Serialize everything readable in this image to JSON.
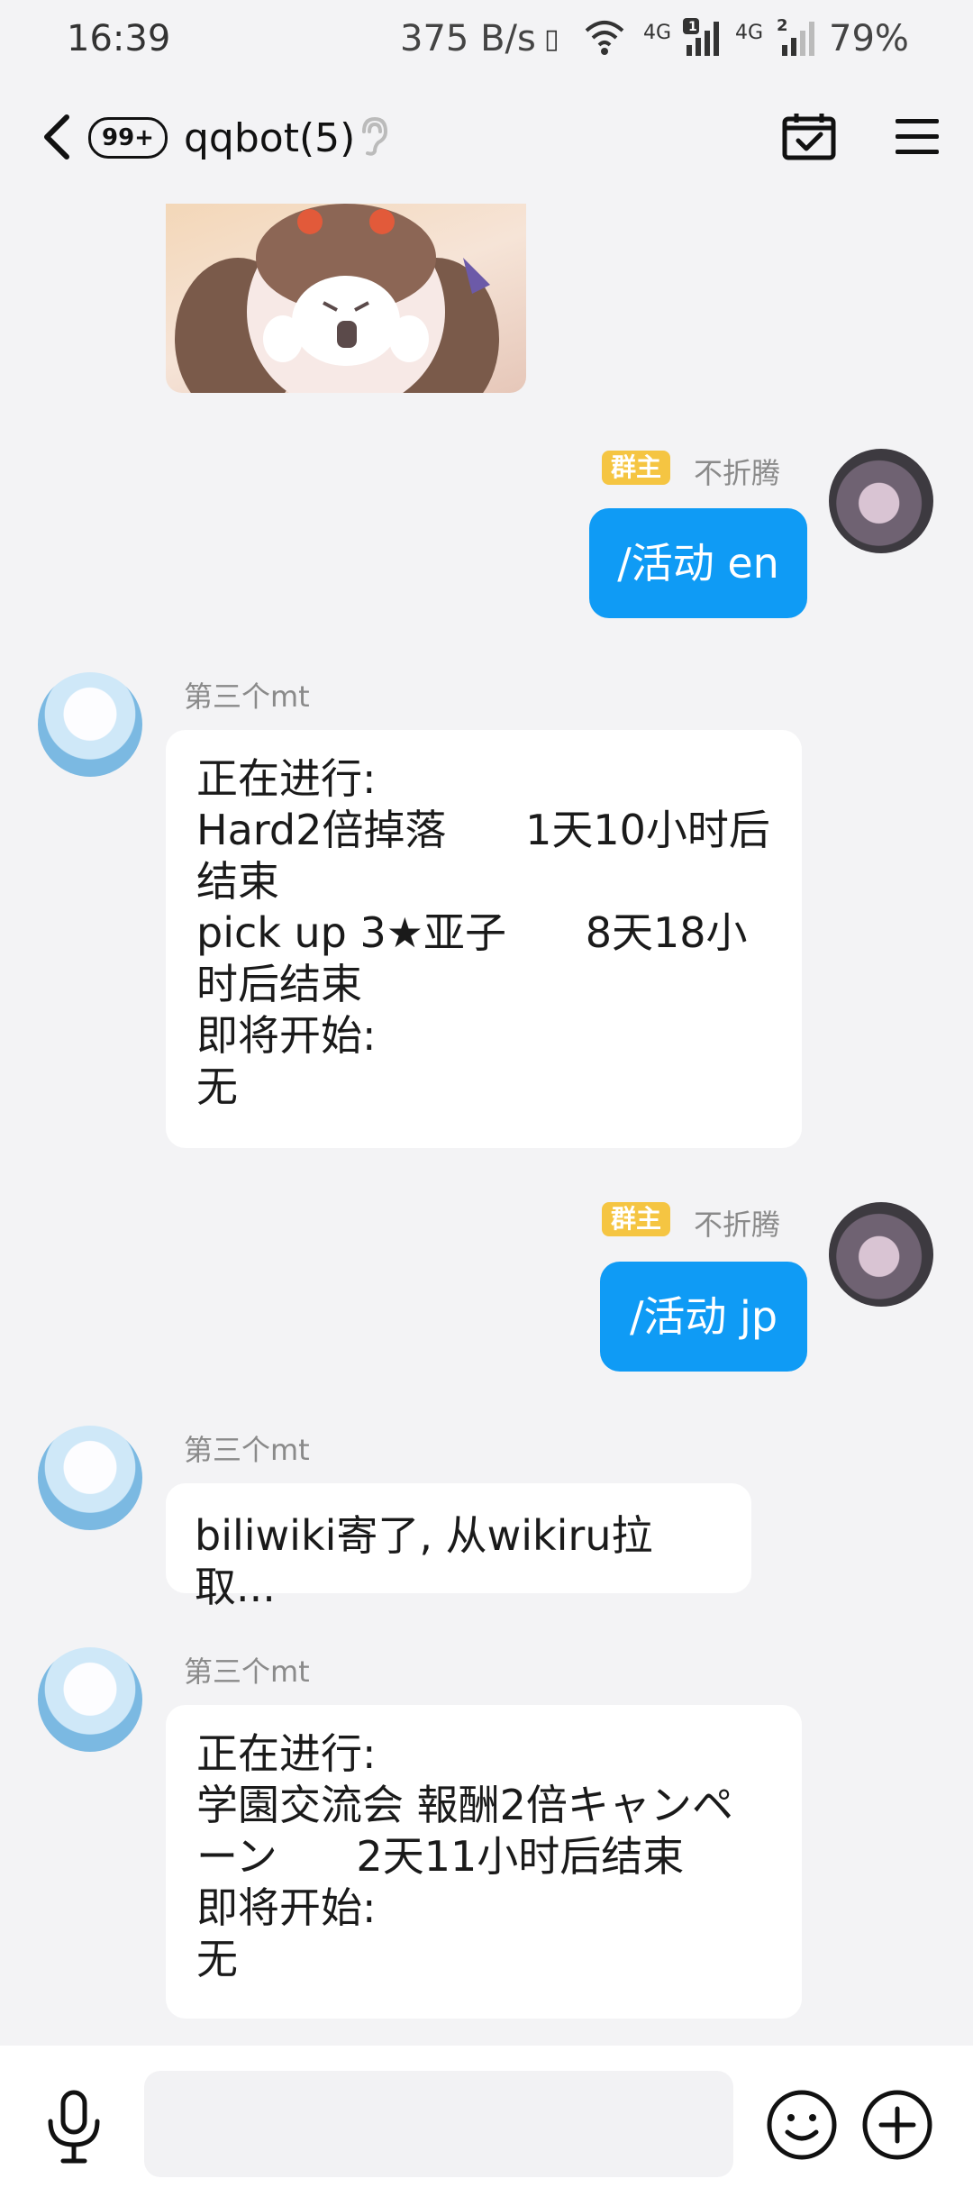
{
  "status_bar": {
    "time": "16:39",
    "net_speed": "375 B/s",
    "signal_1": "4G",
    "sim_1": "1",
    "signal_2": "4G",
    "sim_2": "2",
    "battery": "79%"
  },
  "header": {
    "unread_badge": "99+",
    "title": "qqbot(5)"
  },
  "messages": [
    {
      "side": "right",
      "role": "群主",
      "sender": "不折腾",
      "text": "/活动 en"
    },
    {
      "side": "left",
      "sender": "第三个mt",
      "text": "正在进行:\nHard2倍掉落      1天10小时后结束\npick up 3★亚子      8天18小时后结束\n即将开始:\n无"
    },
    {
      "side": "right",
      "role": "群主",
      "sender": "不折腾",
      "text": "/活动 jp"
    },
    {
      "side": "left",
      "sender": "第三个mt",
      "text": "biliwiki寄了, 从wikiru拉取..."
    },
    {
      "side": "left",
      "sender": "第三个mt",
      "text": "正在进行:\n学園交流会 報酬2倍キャンペーン      2天11小时后结束\n即将开始:\n无"
    }
  ],
  "input": {
    "placeholder": ""
  },
  "colors": {
    "accent": "#0f9bf5",
    "owner_badge": "#f5c542",
    "background": "#f3f3f5"
  }
}
